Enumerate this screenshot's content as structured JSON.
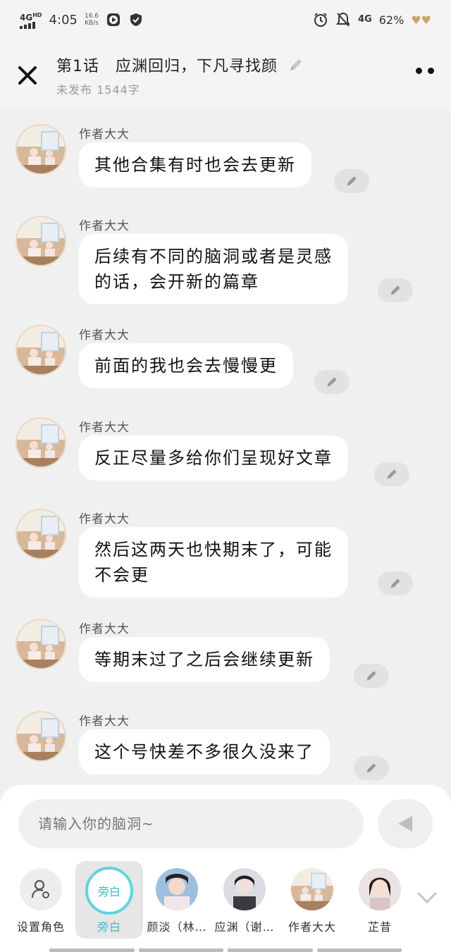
{
  "statusbar": {
    "network": "4G",
    "network_sup": "HD",
    "time": "4:05",
    "speed_value": "16.6",
    "speed_unit": "KB/s",
    "network_right": "4G",
    "battery": "62%",
    "icons": [
      "signal-icon",
      "play-icon",
      "shield-icon",
      "alarm-icon",
      "mute-bell-icon",
      "hearts-icon"
    ]
  },
  "header": {
    "title": "第1话　应渊回归，下凡寻找颜",
    "subtitle": "未发布 1544字"
  },
  "messages": [
    {
      "sender": "作者大大",
      "lines": [
        "其他合集有时也会去更新"
      ]
    },
    {
      "sender": "作者大大",
      "lines": [
        "后续有不同的脑洞或者是灵感",
        "的话，会开新的篇章"
      ]
    },
    {
      "sender": "作者大大",
      "lines": [
        "前面的我也会去慢慢更"
      ]
    },
    {
      "sender": "作者大大",
      "lines": [
        "反正尽量多给你们呈现好文章"
      ]
    },
    {
      "sender": "作者大大",
      "lines": [
        "然后这两天也快期末了，可能",
        "不会更"
      ]
    },
    {
      "sender": "作者大大",
      "lines": [
        "等期末过了之后会继续更新"
      ]
    },
    {
      "sender": "作者大大",
      "lines": [
        "这个号快差不多很久没来了"
      ]
    }
  ],
  "composer": {
    "placeholder": "请输入你的脑洞~"
  },
  "roles": [
    {
      "label": "设置角色"
    },
    {
      "label": "旁白",
      "badge": "旁白",
      "active": true
    },
    {
      "label": "颜淡（林…"
    },
    {
      "label": "应渊（谢…"
    },
    {
      "label": "作者大大"
    },
    {
      "label": "芷昔"
    }
  ],
  "colors": {
    "accent": "#3fb8c9",
    "ring": "#5fd4e0",
    "background": "#f0f0f0",
    "bubble": "#ffffff"
  }
}
